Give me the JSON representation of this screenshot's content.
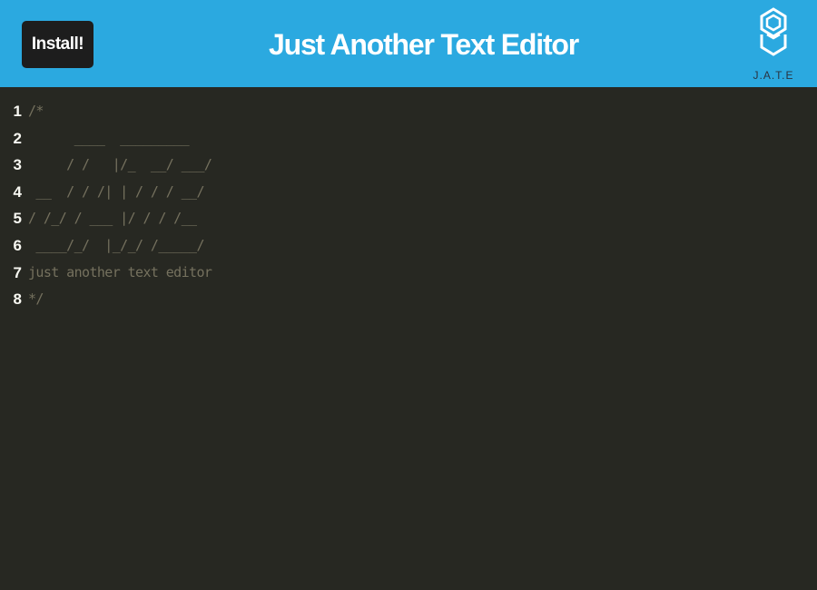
{
  "header": {
    "install_label": "Install!",
    "title": "Just Another Text Editor",
    "logo_text": "J.A.T.E",
    "logo_icon": "jate-logo-icon"
  },
  "editor": {
    "lines": [
      {
        "num": "1",
        "text": "/*"
      },
      {
        "num": "2",
        "text": "      ____  _________"
      },
      {
        "num": "3",
        "text": "     / /   |/_  __/ ___/"
      },
      {
        "num": "4",
        "text": " __  / / /| | / / / __/"
      },
      {
        "num": "5",
        "text": "/ /_/ / ___ |/ / / /__"
      },
      {
        "num": "6",
        "text": " ____/_/  |_/_/ /_____/"
      },
      {
        "num": "7",
        "text": "just another text editor"
      },
      {
        "num": "8",
        "text": "*/"
      }
    ]
  },
  "colors": {
    "header_bg": "#2ba9e0",
    "editor_bg": "#272822",
    "comment": "#75715e",
    "line_number": "#f8f8f2"
  }
}
